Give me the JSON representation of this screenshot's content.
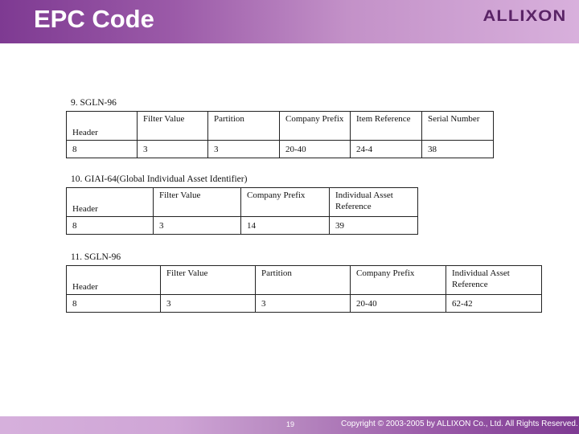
{
  "slide": {
    "title": "EPC Code",
    "logo": "ALLIXON",
    "page_number": "19",
    "copyright": "Copyright © 2003-2005 by ALLIXON Co., Ltd. All Rights Reserved.",
    "colors": {
      "title_bar_dark": "#7e3a92",
      "title_bar_light": "#d8b0dc",
      "logo": "#5a2466"
    }
  },
  "sections": [
    {
      "title": "9. SGLN-96",
      "columns": [
        "Header",
        "Filter Value",
        "Partition",
        "Company Prefix",
        "Item Reference",
        "Serial Number"
      ],
      "values": [
        "8",
        "3",
        "3",
        "20-40",
        "24-4",
        "38"
      ]
    },
    {
      "title": "10. GIAI-64(Global Individual Asset Identifier)",
      "columns": [
        "Header",
        "Filter Value",
        "Company Prefix",
        "Individual Asset Reference"
      ],
      "values": [
        "8",
        "3",
        "14",
        "39"
      ]
    },
    {
      "title": "11. SGLN-96",
      "columns": [
        "Header",
        "Filter Value",
        "Partition",
        "Company Prefix",
        "Individual Asset Reference"
      ],
      "values": [
        "8",
        "3",
        "3",
        "20-40",
        "62-42"
      ]
    }
  ]
}
